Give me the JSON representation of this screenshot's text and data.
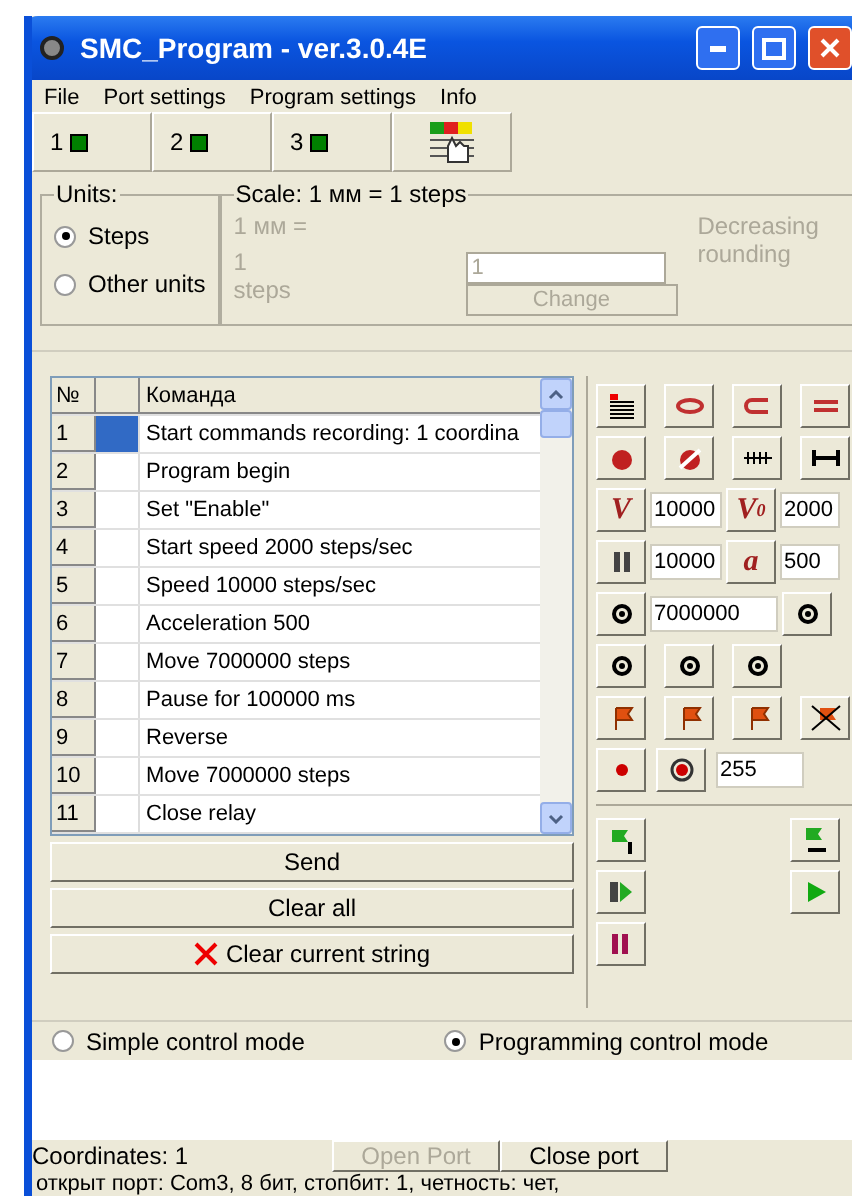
{
  "window": {
    "title": "SMC_Program - ver.3.0.4E"
  },
  "menu": [
    "File",
    "Port settings",
    "Program settings",
    "Info"
  ],
  "axes": [
    {
      "label": "1",
      "color": "#008000"
    },
    {
      "label": "2",
      "color": "#008000"
    },
    {
      "label": "3",
      "color": "#008000"
    }
  ],
  "units": {
    "legend": "Units:",
    "options": [
      {
        "label": "Steps",
        "selected": true
      },
      {
        "label": "Other units",
        "selected": false
      }
    ]
  },
  "scale": {
    "legend": "Scale:  1 мм = 1 steps",
    "mm_label": "1 мм =",
    "steps_value": "1",
    "steps_label": "steps",
    "input_value": "1",
    "change_button": "Change",
    "rounding_label": "Decreasing rounding",
    "disabled": true
  },
  "table": {
    "columns": [
      "№",
      "Команда"
    ],
    "rows": [
      {
        "num": "1",
        "command": "Start commands recording: 1 coordina",
        "selected": true
      },
      {
        "num": "2",
        "command": "Program begin",
        "selected": false
      },
      {
        "num": "3",
        "command": "Set \"Enable\"",
        "selected": false
      },
      {
        "num": "4",
        "command": "Start speed 2000 steps/sec",
        "selected": false
      },
      {
        "num": "5",
        "command": "Speed 10000 steps/sec",
        "selected": false
      },
      {
        "num": "6",
        "command": "Acceleration 500",
        "selected": false
      },
      {
        "num": "7",
        "command": "Move 7000000 steps",
        "selected": false
      },
      {
        "num": "8",
        "command": "Pause for 100000 ms",
        "selected": false
      },
      {
        "num": "9",
        "command": "Reverse",
        "selected": false
      },
      {
        "num": "10",
        "command": "Move 7000000 steps",
        "selected": false
      },
      {
        "num": "11",
        "command": "Close relay",
        "selected": false
      }
    ]
  },
  "actions": [
    "Send",
    "Clear all",
    "Clear current string"
  ],
  "params": {
    "speed_label": "V",
    "speed": "10000",
    "start_speed_label": "V",
    "start_speed_sub": "0",
    "start_speed": "2000",
    "pause": "10000",
    "accel_label": "a",
    "accel": "500",
    "move": "7000000",
    "relay": "255"
  },
  "modes": [
    {
      "label": "Simple control mode",
      "selected": false
    },
    {
      "label": "Programming control mode",
      "selected": true
    }
  ],
  "status": {
    "coordinates": "Coordinates:  1",
    "open_port": "Open Port",
    "open_port_disabled": true,
    "close_port": "Close port",
    "log": "открыт порт:   Com3,  8 бит, стопбит: 1,  четность: чет,"
  }
}
